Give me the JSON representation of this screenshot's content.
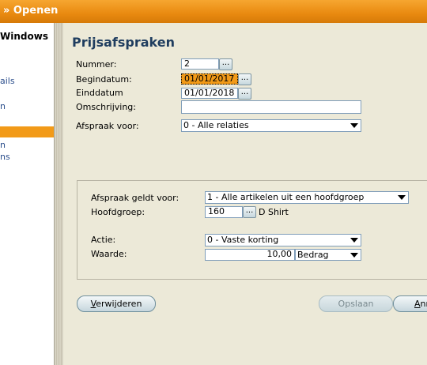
{
  "titlebar": {
    "text": "» Openen"
  },
  "sidebar": {
    "header": "Windows",
    "items": [
      "ails",
      "n",
      "",
      "n",
      "ns"
    ]
  },
  "form": {
    "title": "Prijsafspraken",
    "nummer": {
      "label": "Nummer:",
      "value": "2"
    },
    "begindatum": {
      "label": "Begindatum:",
      "value": "01/01/2017"
    },
    "einddatum": {
      "label": "Einddatum",
      "value": "01/01/2018"
    },
    "omschrijving": {
      "label": "Omschrijving:",
      "value": ""
    },
    "afspraak_voor": {
      "label": "Afspraak voor:",
      "value": "0 - Alle relaties"
    },
    "geldt_voor": {
      "label": "Afspraak geldt voor:",
      "value": "1 - Alle artikelen uit een hoofdgroep"
    },
    "hoofdgroep": {
      "label": "Hoofdgroep:",
      "value": "160",
      "desc": "D Shirt"
    },
    "actie": {
      "label": "Actie:",
      "value": "0 - Vaste korting"
    },
    "waarde": {
      "label": "Waarde:",
      "value": "10,00",
      "unit": "Bedrag"
    },
    "dots": "..."
  },
  "buttons": {
    "delete": {
      "pre": "",
      "hot": "V",
      "post": "erwijderen"
    },
    "save": "Opslaan",
    "cancel": {
      "pre": "",
      "hot": "A",
      "post": "nn"
    }
  },
  "colors": {
    "accent": "#f29a18",
    "title": "#1f3d5f"
  }
}
